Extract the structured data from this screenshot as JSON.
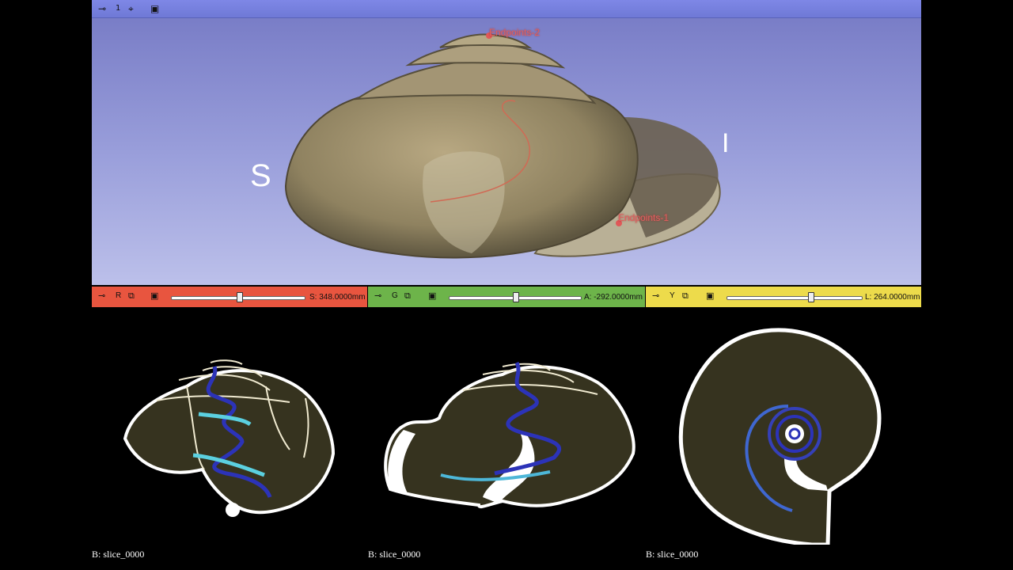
{
  "view3d": {
    "view_number": "1",
    "orientation_left": "S",
    "orientation_right": "I",
    "fiducials": [
      "Endpoints-2",
      "Endpoints-1"
    ]
  },
  "slice_red": {
    "letter": "R",
    "value_text": "S: 348.0000mm",
    "slider_fraction": 0.5,
    "background_label": "B: slice_0000",
    "color": "#e8553f"
  },
  "slice_green": {
    "letter": "G",
    "value_text": "A: -292.0000mm",
    "slider_fraction": 0.5,
    "background_label": "B: slice_0000",
    "color": "#6db44a"
  },
  "slice_yellow": {
    "letter": "Y",
    "value_text": "L: 264.0000mm",
    "slider_fraction": 0.63,
    "background_label": "B: slice_0000",
    "color": "#eddb4b"
  }
}
